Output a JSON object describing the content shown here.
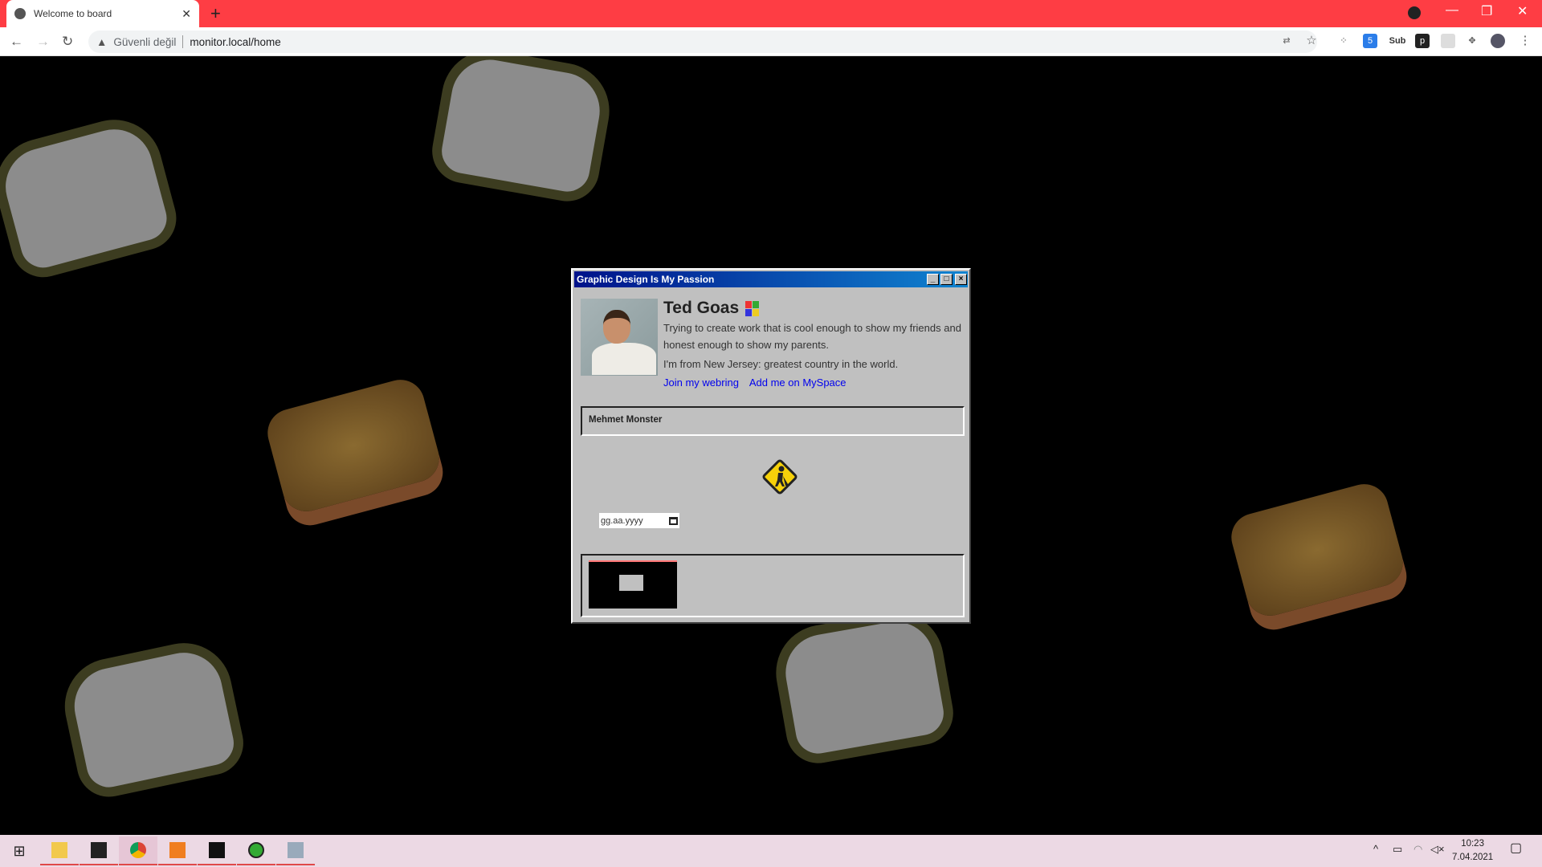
{
  "browser": {
    "tab_title": "Welcome to board",
    "security_label": "Güvenli değil",
    "url": "monitor.local/home",
    "extension_badge": "5",
    "ext_sub": "Sub"
  },
  "window": {
    "title": "Graphic Design Is My Passion",
    "profile": {
      "name": "Ted Goas",
      "bio": "Trying to create work that is cool enough to show my friends and honest enough to show my parents.",
      "origin": "I'm from New Jersey: greatest country in the world.",
      "links": [
        "Join my webring",
        "Add me on MySpace"
      ]
    },
    "section_title": "Mehmet Monster",
    "date_placeholder": "gg.aa.yyyy"
  },
  "taskbar": {
    "time": "10:23",
    "date": "7.04.2021"
  },
  "colors": {
    "tabbar": "#fe3d44",
    "titlebar_start": "#00128a",
    "titlebar_end": "#1084d0",
    "window_bg": "#c0c0c0",
    "link": "#0000ee"
  }
}
